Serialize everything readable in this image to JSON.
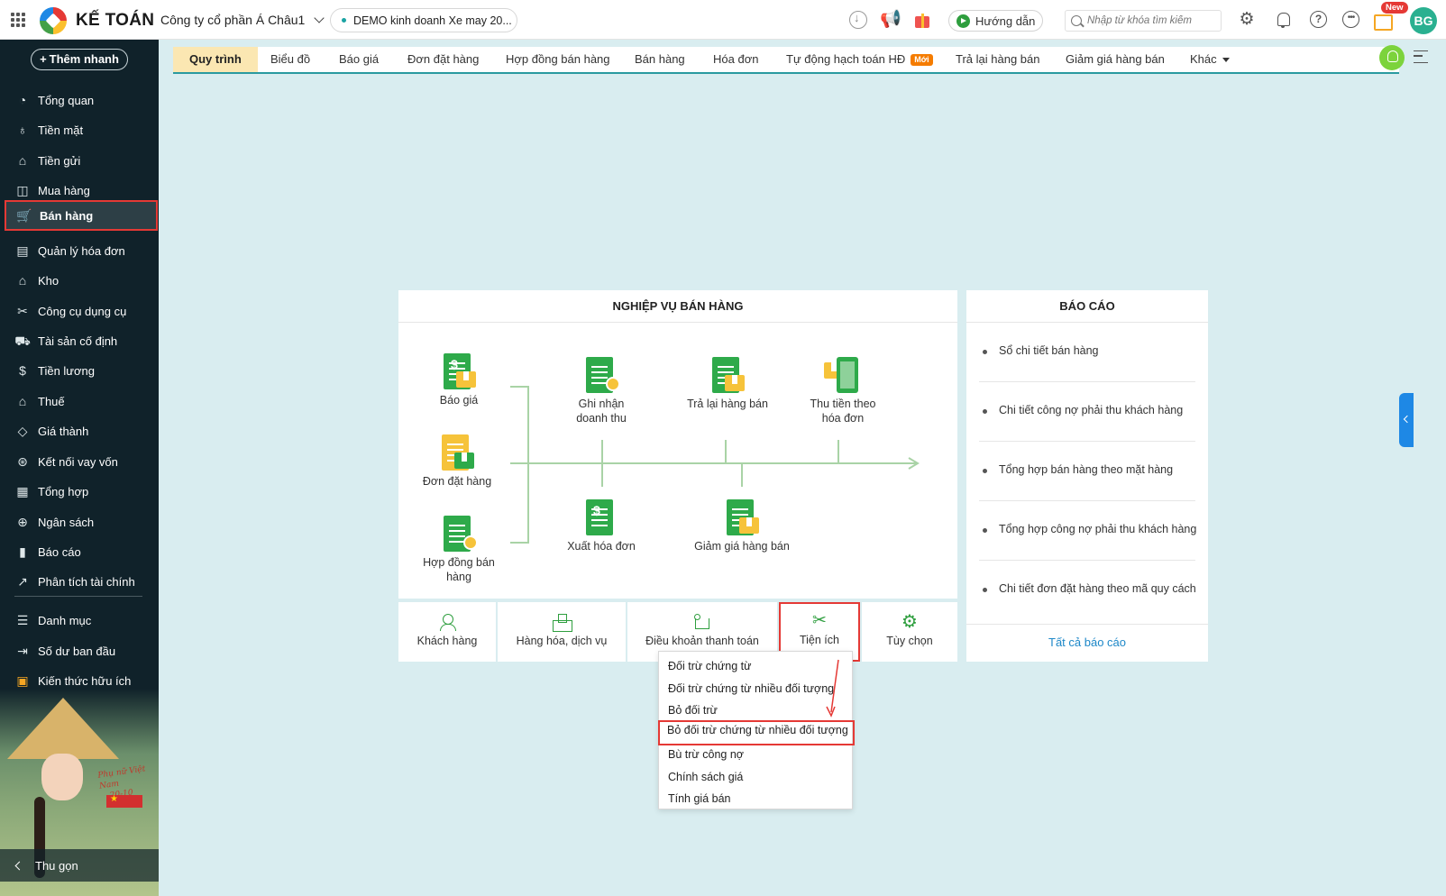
{
  "header": {
    "app_name": "KẾ TOÁN",
    "company": "Công ty cổ phần Á Châu1",
    "database": "DEMO kinh doanh Xe may 20...",
    "guide_label": "Hướng dẫn",
    "search_placeholder": "Nhập từ khóa tìm kiếm",
    "new_badge": "New",
    "avatar_initials": "BG"
  },
  "sidebar": {
    "quick_add_label": "Thêm nhanh",
    "items": [
      {
        "label": "Tổng quan",
        "icon": "dashboard-icon"
      },
      {
        "label": "Tiền mặt",
        "icon": "cash-icon"
      },
      {
        "label": "Tiền gửi",
        "icon": "bank-icon"
      },
      {
        "label": "Mua hàng",
        "icon": "bag-icon"
      },
      {
        "label": "Bán hàng",
        "icon": "cart-icon",
        "active": true
      },
      {
        "label": "Quản lý hóa đơn",
        "icon": "invoice-icon"
      },
      {
        "label": "Kho",
        "icon": "warehouse-icon"
      },
      {
        "label": "Công cụ dụng cụ",
        "icon": "tools-icon"
      },
      {
        "label": "Tài sản cố định",
        "icon": "asset-icon"
      },
      {
        "label": "Tiền lương",
        "icon": "salary-icon"
      },
      {
        "label": "Thuế",
        "icon": "tax-icon"
      },
      {
        "label": "Giá thành",
        "icon": "price-tag-icon"
      },
      {
        "label": "Kết nối vay vốn",
        "icon": "loan-icon"
      },
      {
        "label": "Tổng hợp",
        "icon": "summary-icon"
      },
      {
        "label": "Ngân sách",
        "icon": "budget-icon"
      },
      {
        "label": "Báo cáo",
        "icon": "report-icon"
      },
      {
        "label": "Phân tích tài chính",
        "icon": "analytics-icon"
      },
      {
        "label": "Danh mục",
        "icon": "list-icon"
      },
      {
        "label": "Số dư ban đầu",
        "icon": "opening-balance-icon"
      },
      {
        "label": "Kiến thức hữu ích",
        "icon": "knowledge-icon"
      }
    ],
    "art_text_1": "Phụ nữ Việt Nam",
    "art_text_2": "20-10",
    "collapse_label": "Thu gọn"
  },
  "tabs": {
    "items": [
      "Quy trình",
      "Biểu đồ",
      "Báo giá",
      "Đơn đặt hàng",
      "Hợp đồng bán hàng",
      "Bán hàng",
      "Hóa đơn",
      "Tự động hạch toán HĐ",
      "Trả lại hàng bán",
      "Giảm giá hàng bán",
      "Khác"
    ],
    "active": "Quy trình",
    "moi_badge": "Mới"
  },
  "process": {
    "title": "NGHIỆP VỤ BÁN HÀNG",
    "nodes": {
      "quote": "Báo giá",
      "order": "Đơn đặt hàng",
      "contract_1": "Hợp đồng bán",
      "contract_2": "hàng",
      "revenue_1": "Ghi nhận",
      "revenue_2": "doanh thu",
      "return": "Trả lại hàng bán",
      "collect_1": "Thu tiền theo",
      "collect_2": "hóa đơn",
      "issue_invoice": "Xuất hóa đơn",
      "discount": "Giảm giá hàng bán"
    }
  },
  "tools": {
    "customer": "Khách hàng",
    "goods": "Hàng hóa, dịch vụ",
    "terms": "Điều khoản thanh toán",
    "utilities": "Tiện ích",
    "options": "Tùy chọn"
  },
  "reports": {
    "title": "BÁO CÁO",
    "items": [
      "Sổ chi tiết bán hàng",
      "Chi tiết công nợ phải thu khách hàng",
      "Tổng hợp bán hàng theo mặt hàng",
      "Tổng hợp công nợ phải thu khách hàng",
      "Chi tiết đơn đặt hàng theo mã quy cách"
    ],
    "all_label": "Tất cả báo cáo"
  },
  "dropdown": {
    "items": [
      "Đối trừ chứng từ",
      "Đối trừ chứng từ nhiều đối tượng",
      "Bỏ đối trừ",
      "Bỏ đối trừ chứng từ nhiều đối tượng",
      "Bù trừ công nợ",
      "Chính sách giá",
      "Tính giá bán"
    ],
    "highlighted": "Bỏ đối trừ chứng từ nhiều đối tượng"
  },
  "colors": {
    "sidebar_bg": "#10222a",
    "main_bg": "#d9edf0",
    "accent_green": "#2eaa4a",
    "highlight_red": "#e53935",
    "active_tab_bg": "#fbe7b2",
    "link_blue": "#1e88c8"
  }
}
